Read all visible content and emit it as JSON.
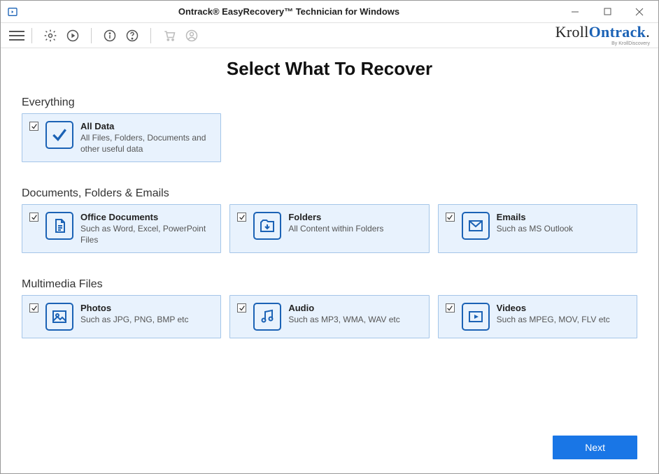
{
  "window": {
    "title": "Ontrack® EasyRecovery™ Technician for Windows"
  },
  "brand": {
    "left": "Kroll",
    "right": "Ontrack",
    "sub": "By KrollDiscovery"
  },
  "page": {
    "title": "Select What To Recover"
  },
  "sections": {
    "everything": {
      "title": "Everything",
      "card": {
        "title": "All Data",
        "desc": "All Files, Folders, Documents and other useful data"
      }
    },
    "docs": {
      "title": "Documents, Folders & Emails",
      "cards": [
        {
          "title": "Office Documents",
          "desc": "Such as Word, Excel, PowerPoint Files"
        },
        {
          "title": "Folders",
          "desc": "All Content within Folders"
        },
        {
          "title": "Emails",
          "desc": "Such as MS Outlook"
        }
      ]
    },
    "media": {
      "title": "Multimedia Files",
      "cards": [
        {
          "title": "Photos",
          "desc": "Such as JPG, PNG, BMP etc"
        },
        {
          "title": "Audio",
          "desc": "Such as MP3, WMA, WAV etc"
        },
        {
          "title": "Videos",
          "desc": "Such as MPEG, MOV, FLV etc"
        }
      ]
    }
  },
  "buttons": {
    "next": "Next"
  }
}
